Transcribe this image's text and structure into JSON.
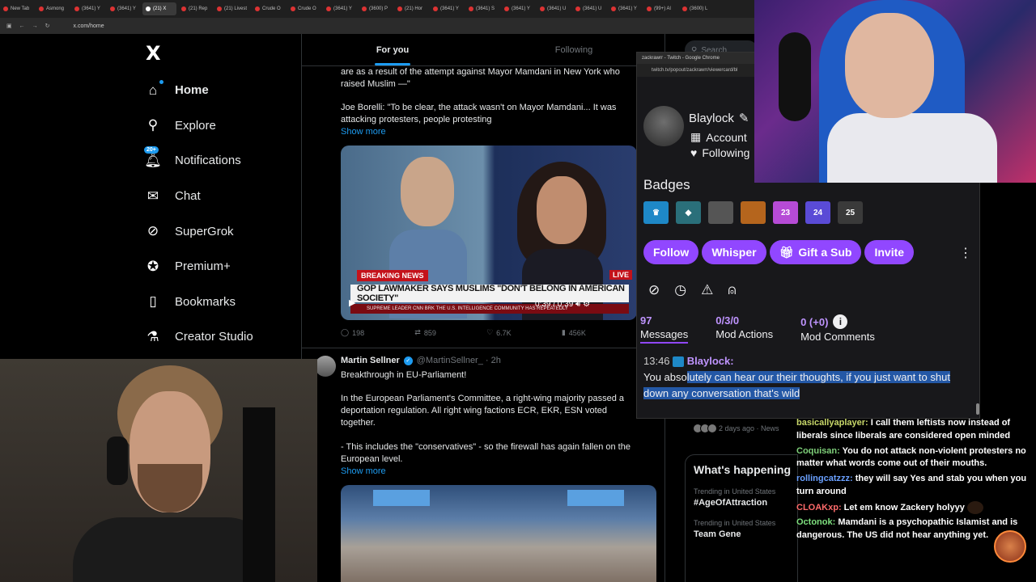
{
  "browser": {
    "tabs": [
      "New Tab",
      "Asmong",
      "(3641) Y",
      "(3641) Y",
      "(21) X",
      "(21) Rep",
      "(21) Livest",
      "Crude O",
      "Crude O",
      "(3641) Y",
      "(3600) P",
      "(21) Hor",
      "(3641) Y",
      "(3641) S",
      "(3641) Y",
      "(3641) U",
      "(3641) U",
      "(3641) Y",
      "(99+) Al",
      "(3600) L"
    ],
    "url": "x.com/home"
  },
  "nav": {
    "logo": "X",
    "items": [
      {
        "label": "Home",
        "icon": "home-icon"
      },
      {
        "label": "Explore",
        "icon": "search-icon"
      },
      {
        "label": "Notifications",
        "icon": "bell-icon"
      },
      {
        "label": "Chat",
        "icon": "mail-icon"
      },
      {
        "label": "SuperGrok",
        "icon": "grok-icon"
      },
      {
        "label": "Premium+",
        "icon": "verified-icon"
      },
      {
        "label": "Bookmarks",
        "icon": "bookmark-icon"
      },
      {
        "label": "Creator Studio",
        "icon": "flask-icon"
      }
    ],
    "notif_badge": "20+"
  },
  "timeline": {
    "tabs": [
      "For you",
      "Following"
    ],
    "tweet1": {
      "text1": "are as a result of the attempt against Mayor Mamdani in New York who raised Muslim —\"",
      "text2": "Joe Borelli: \"To be clear, the attack wasn't on Mayor Mamdani... It was attacking protesters, people protesting",
      "show_more": "Show more",
      "breaking": "BREAKING NEWS",
      "chyron": "GOP LAWMAKER SAYS MUSLIMS \"DON'T BELONG IN AMERICAN SOCIETY\"",
      "live": "LIVE",
      "ticker": "SUPREME LEADER    CNN BRK    THE U.S. INTELLIGENCE COMMUNITY HAS REPEATEDLY",
      "video_time": "0:39 / 0:39",
      "replies": "198",
      "reposts": "859",
      "likes": "6.7K",
      "views": "456K"
    },
    "tweet2": {
      "name": "Martin Sellner",
      "handle": "@MartinSellner_ · 2h",
      "line1": "Breakthrough in EU-Parliament!",
      "para1": "In the European Parliament's Committee, a right-wing majority passed a deportation regulation. All right wing factions ECR, EKR, ESN voted together.",
      "para2": "- This includes the \"conservatives\" - so the firewall has again fallen on the European level.",
      "show_more": "Show more"
    }
  },
  "right": {
    "search_placeholder": "Search",
    "news_time": "2 days ago · News",
    "whats_happening": "What's happening",
    "trends": [
      {
        "context": "Trending in United States",
        "title": "#AgeOfAttraction"
      },
      {
        "context": "Trending in United States",
        "title": "Team Gene"
      }
    ]
  },
  "popout": {
    "title": "zackrawrr - Twitch - Google Chrome",
    "url": "twitch.tv/popout/zackrawrr/viewercard/bl",
    "username": "Blaylock",
    "account_line": "Account",
    "following_line": "Following",
    "badges_title": "Badges",
    "badges": [
      "crown",
      "diamond",
      "",
      "",
      "23",
      "24",
      "25"
    ],
    "buttons": [
      "Follow",
      "Whisper",
      "Gift a Sub",
      "Invite"
    ],
    "stats": [
      {
        "value": "97",
        "label": "Messages"
      },
      {
        "value": "0/3/0",
        "label": "Mod Actions"
      },
      {
        "value": "0 (+0)",
        "label": "Mod Comments"
      }
    ],
    "message": {
      "time": "13:46",
      "user": "Blaylock:",
      "text_pre": "You abso",
      "text_sel": "lutely can hear our their thoughts, if you just want to shut down any conversation that's wild"
    }
  },
  "chat": [
    {
      "user": "basicallyaplayer:",
      "text": "I call them leftists now instead of liberals since liberals are considered open minded"
    },
    {
      "user": "Coquisan:",
      "text": "You do not attack non-violent protesters no matter what words come out of their mouths."
    },
    {
      "user": "rollingcatzzz:",
      "text": "they will say Yes and stab you when you turn around"
    },
    {
      "user": "CLOAKxp:",
      "text": "Let em know Zackery holyyy"
    },
    {
      "user": "Octonok:",
      "text": "Mamdani is a psychopathic Islamist and is dangerous. The US did not hear anything yet."
    }
  ]
}
